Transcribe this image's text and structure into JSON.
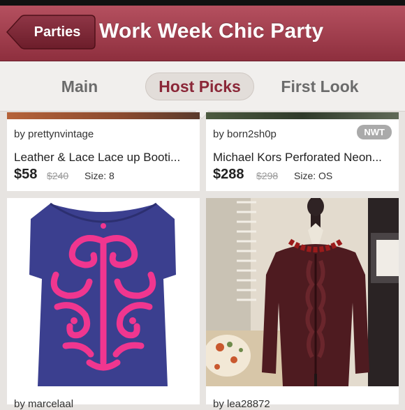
{
  "header": {
    "back_label": "Parties",
    "title": "Work Week Chic Party"
  },
  "tabs": [
    {
      "label": "Main"
    },
    {
      "label": "Host Picks"
    },
    {
      "label": "First Look"
    }
  ],
  "listings": [
    {
      "seller": "by prettynvintage",
      "name": "Leather & Lace Lace up Booti...",
      "price": "$58",
      "original_price": "$240",
      "size": "Size: 8",
      "badge": ""
    },
    {
      "seller": "by born2sh0p",
      "name": "Michael Kors Perforated Neon...",
      "price": "$288",
      "original_price": "$298",
      "size": "Size: OS",
      "badge": "NWT"
    },
    {
      "seller": "by marcelaal"
    },
    {
      "seller": "by lea28872"
    }
  ],
  "colors": {
    "header": "#a3404f",
    "active_tab_text": "#8b2738"
  }
}
